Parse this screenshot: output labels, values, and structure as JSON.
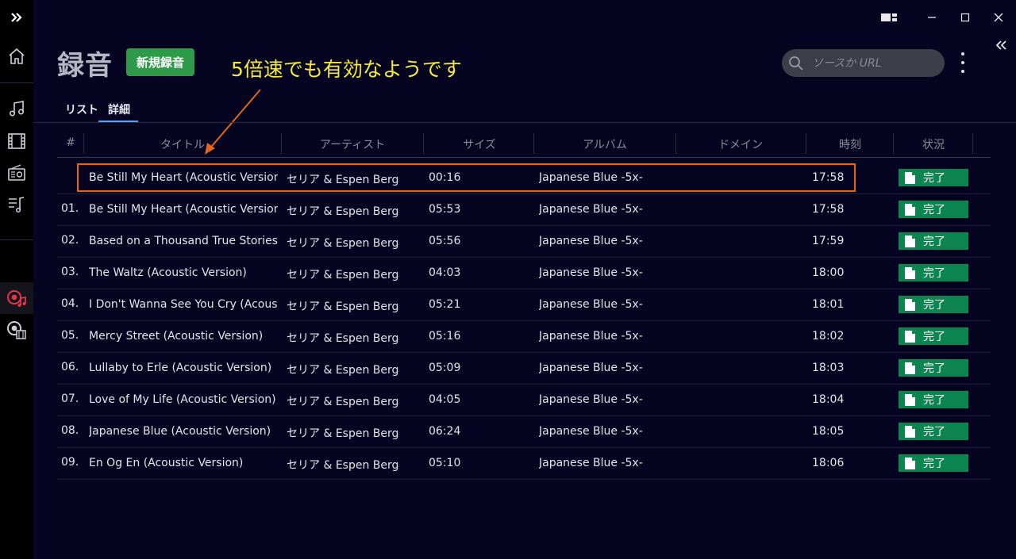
{
  "header": {
    "title": "録音",
    "new_recording_label": "新規録音",
    "annotation_text": "5倍速でも有効なようです",
    "search_placeholder": "ソースか URL"
  },
  "tabs": [
    {
      "label": "リスト",
      "active": false
    },
    {
      "label": "詳細",
      "active": true
    }
  ],
  "table": {
    "columns": [
      "#",
      "タイトル",
      "アーティスト",
      "サイズ",
      "アルバム",
      "ドメイン",
      "時刻",
      "状況"
    ],
    "rows": [
      {
        "num": "",
        "title": "Be Still My Heart (Acoustic Version)",
        "artist": "セリア & Espen Berg",
        "size": "00:16",
        "album": "Japanese Blue -5x-",
        "domain": "",
        "time": "17:58",
        "status": "完了"
      },
      {
        "num": "01.",
        "title": "Be Still My Heart (Acoustic Version)",
        "artist": "セリア & Espen Berg",
        "size": "05:53",
        "album": "Japanese Blue -5x-",
        "domain": "",
        "time": "17:58",
        "status": "完了"
      },
      {
        "num": "02.",
        "title": "Based on a Thousand True Stories (A...",
        "artist": "セリア & Espen Berg",
        "size": "05:56",
        "album": "Japanese Blue -5x-",
        "domain": "",
        "time": "17:59",
        "status": "完了"
      },
      {
        "num": "03.",
        "title": "The Waltz (Acoustic Version)",
        "artist": "セリア & Espen Berg",
        "size": "04:03",
        "album": "Japanese Blue -5x-",
        "domain": "",
        "time": "18:00",
        "status": "完了"
      },
      {
        "num": "04.",
        "title": "I Don't Wanna See You Cry (Acoustic...",
        "artist": "セリア & Espen Berg",
        "size": "05:21",
        "album": "Japanese Blue -5x-",
        "domain": "",
        "time": "18:01",
        "status": "完了"
      },
      {
        "num": "05.",
        "title": "Mercy Street (Acoustic Version)",
        "artist": "セリア & Espen Berg",
        "size": "05:16",
        "album": "Japanese Blue -5x-",
        "domain": "",
        "time": "18:02",
        "status": "完了"
      },
      {
        "num": "06.",
        "title": "Lullaby to Erle (Acoustic Version)",
        "artist": "セリア & Espen Berg",
        "size": "05:09",
        "album": "Japanese Blue -5x-",
        "domain": "",
        "time": "18:03",
        "status": "完了"
      },
      {
        "num": "07.",
        "title": "Love of My Life (Acoustic Version)",
        "artist": "セリア & Espen Berg",
        "size": "04:05",
        "album": "Japanese Blue -5x-",
        "domain": "",
        "time": "18:04",
        "status": "完了"
      },
      {
        "num": "08.",
        "title": "Japanese Blue (Acoustic Version)",
        "artist": "セリア & Espen Berg",
        "size": "06:24",
        "album": "Japanese Blue -5x-",
        "domain": "",
        "time": "18:05",
        "status": "完了"
      },
      {
        "num": "09.",
        "title": "En Og En (Acoustic Version)",
        "artist": "セリア & Espen Berg",
        "size": "05:10",
        "album": "Japanese Blue -5x-",
        "domain": "",
        "time": "18:06",
        "status": "完了"
      }
    ]
  },
  "colors": {
    "background": "#050522",
    "accent_green": "#2f9a4a",
    "status_green": "#0d8550",
    "annotation_yellow": "#f6ea3c",
    "annotation_orange": "#e0651f",
    "tab_underline": "#4fa6ff",
    "active_nav_icon": "#e8354a"
  },
  "icons": {
    "sidebar": [
      "expand-icon",
      "home-icon",
      "music-icon",
      "film-icon",
      "radio-icon",
      "playlist-icon",
      "record-music-icon",
      "record-video-icon"
    ],
    "window": [
      "snap-layout-icon",
      "minimize-icon",
      "maximize-icon",
      "close-icon"
    ]
  }
}
